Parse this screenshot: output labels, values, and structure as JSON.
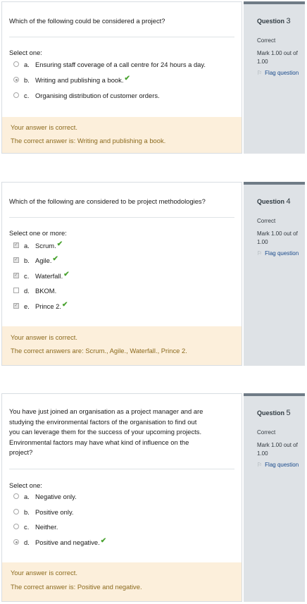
{
  "questions": [
    {
      "number_label": "Question",
      "number": "3",
      "state": "Correct",
      "mark": "Mark 1.00 out of 1.00",
      "flag": "Flag question",
      "text": "Which of the following could be considered a project?",
      "prompt": "Select one:",
      "options": [
        {
          "letter": "a.",
          "label": "Ensuring staff coverage of a call centre for 24 hours a day.",
          "checked": false,
          "tick": false
        },
        {
          "letter": "b.",
          "label": "Writing and publishing a book.",
          "checked": true,
          "tick": true
        },
        {
          "letter": "c.",
          "label": "Organising distribution of customer orders.",
          "checked": false,
          "tick": false
        }
      ],
      "feedback_status": "Your answer is correct.",
      "feedback_answer": "The correct answer is: Writing and publishing a book."
    },
    {
      "number_label": "Question",
      "number": "4",
      "state": "Correct",
      "mark": "Mark 1.00 out of 1.00",
      "flag": "Flag question",
      "text": "Which of the following are considered to be project methodologies?",
      "prompt": "Select one or more:",
      "options": [
        {
          "letter": "a.",
          "label": "Scrum.",
          "checked": true,
          "tick": true
        },
        {
          "letter": "b.",
          "label": "Agile.",
          "checked": true,
          "tick": true
        },
        {
          "letter": "c.",
          "label": "Waterfall.",
          "checked": true,
          "tick": true
        },
        {
          "letter": "d.",
          "label": "BKOM.",
          "checked": false,
          "tick": false
        },
        {
          "letter": "e.",
          "label": "Prince 2.",
          "checked": true,
          "tick": true
        }
      ],
      "feedback_status": "Your answer is correct.",
      "feedback_answer": "The correct answers are: Scrum., Agile., Waterfall., Prince 2."
    },
    {
      "number_label": "Question",
      "number": "5",
      "state": "Correct",
      "mark": "Mark 1.00 out of 1.00",
      "flag": "Flag question",
      "text_lines": [
        "You have just joined an organisation as a project manager and are",
        "studying the environmental factors of the organisation to find out",
        "you can leverage them for the success of your upcoming projects.",
        "Environmental factors may have what kind of influence on the",
        "project?"
      ],
      "prompt": "Select one:",
      "options": [
        {
          "letter": "a.",
          "label": "Negative only.",
          "checked": false,
          "tick": false
        },
        {
          "letter": "b.",
          "label": "Positive only.",
          "checked": false,
          "tick": false
        },
        {
          "letter": "c.",
          "label": "Neither.",
          "checked": false,
          "tick": false
        },
        {
          "letter": "d.",
          "label": "Positive and negative.",
          "checked": true,
          "tick": true
        }
      ],
      "feedback_status": "Your answer is correct.",
      "feedback_answer": "The correct answer is: Positive and negative."
    }
  ],
  "tick_glyph": "✔",
  "check_glyph": "✓",
  "flag_glyph": "⚐",
  "colors": {
    "accent_correct": "#4aa330",
    "feedback_bg": "#fcefdb",
    "feedback_text": "#8b6a1e",
    "info_bg": "#dee2e6",
    "flag_link": "#1a4b8c"
  }
}
